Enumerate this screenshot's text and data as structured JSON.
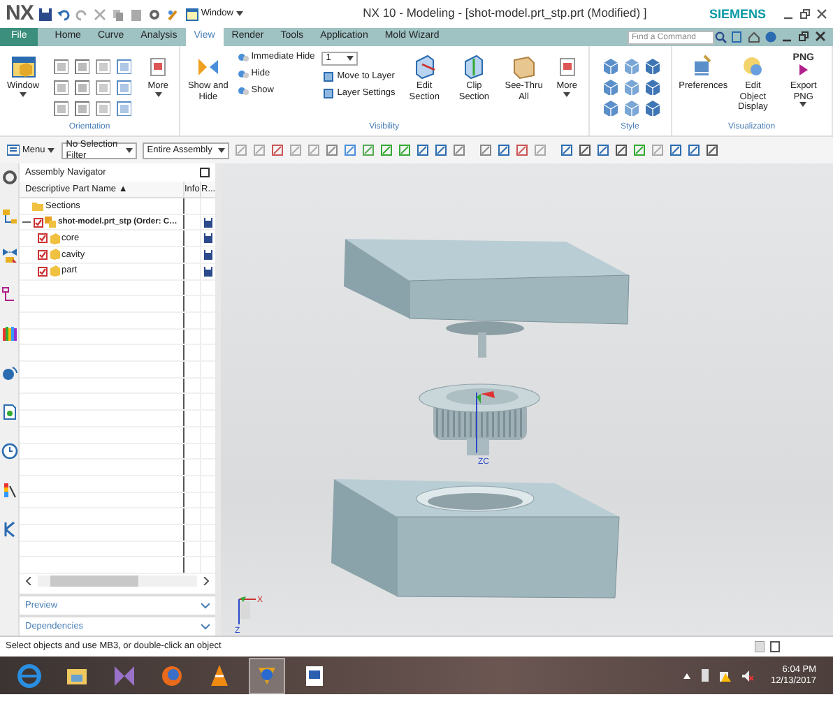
{
  "title_bar": {
    "app": "NX",
    "quick_access": "Window",
    "title": "NX 10 - Modeling - [shot-model.prt_stp.prt (Modified) ]",
    "brand": "SIEMENS"
  },
  "tabs": [
    {
      "label": "File",
      "kind": "file",
      "selected": false
    },
    {
      "label": "Home",
      "kind": "tab",
      "selected": false
    },
    {
      "label": "Curve",
      "kind": "tab",
      "selected": false
    },
    {
      "label": "Analysis",
      "kind": "tab",
      "selected": false
    },
    {
      "label": "View",
      "kind": "tab",
      "selected": true
    },
    {
      "label": "Render",
      "kind": "tab",
      "selected": false
    },
    {
      "label": "Tools",
      "kind": "tab",
      "selected": false
    },
    {
      "label": "Application",
      "kind": "tab",
      "selected": false
    },
    {
      "label": "Mold Wizard",
      "kind": "tab",
      "selected": false
    }
  ],
  "command_search": {
    "placeholder": "Find a Command"
  },
  "ribbon": {
    "groups": [
      {
        "label": "Orientation",
        "items": [
          {
            "kind": "large",
            "label": "Window",
            "caret": true
          },
          {
            "kind": "orientation_grid"
          },
          {
            "kind": "large",
            "label": "More",
            "caret": true
          }
        ]
      },
      {
        "label": "Visibility",
        "items": [
          {
            "kind": "large",
            "label": "Show and Hide",
            "caret": false
          },
          {
            "kind": "small_list",
            "items": [
              "Immediate Hide",
              "Hide",
              "Show"
            ]
          },
          {
            "kind": "layer",
            "value": "1",
            "items": [
              "Move to Layer",
              "Layer Settings"
            ]
          },
          {
            "kind": "large",
            "label": "Edit Section",
            "caret": false
          },
          {
            "kind": "large",
            "label": "Clip Section",
            "caret": false
          },
          {
            "kind": "large",
            "label": "See-Thru All",
            "caret": false
          },
          {
            "kind": "large",
            "label": "More",
            "caret": true
          }
        ]
      },
      {
        "label": "Style",
        "items": [
          {
            "kind": "style_grid"
          }
        ]
      },
      {
        "label": "Visualization",
        "items": [
          {
            "kind": "large",
            "label": "Preferences",
            "caret": false
          },
          {
            "kind": "large",
            "label": "Edit Object Display",
            "caret": false
          },
          {
            "kind": "large",
            "icon_text": "PNG",
            "label": "Export PNG",
            "caret": true
          }
        ]
      }
    ]
  },
  "toolbar": {
    "menu": "Menu",
    "selection_filter": "No Selection Filter",
    "scope": "Entire Assembly"
  },
  "navigator": {
    "title": "Assembly Navigator",
    "columns": [
      "Descriptive Part Name ▲",
      "Info",
      "R..."
    ],
    "tree": [
      {
        "kind": "folder",
        "label": "Sections"
      },
      {
        "kind": "assembly",
        "label": "shot-model.prt_stp (Order: C…",
        "checked": true,
        "expanded": true,
        "children": [
          {
            "kind": "part",
            "label": "core",
            "checked": true
          },
          {
            "kind": "part",
            "label": "cavity",
            "checked": true
          },
          {
            "kind": "part",
            "label": "part",
            "checked": true
          }
        ]
      }
    ],
    "panels": [
      {
        "label": "Preview",
        "expanded": false
      },
      {
        "label": "Dependencies",
        "expanded": false
      }
    ]
  },
  "viewport": {
    "axis_labels": [
      "ZC"
    ],
    "triad_labels": [
      "X",
      "Z"
    ]
  },
  "status_bar": {
    "message": "Select objects and use MB3, or double-click an object"
  },
  "taskbar": {
    "time": "6:04 PM",
    "date": "12/13/2017"
  }
}
